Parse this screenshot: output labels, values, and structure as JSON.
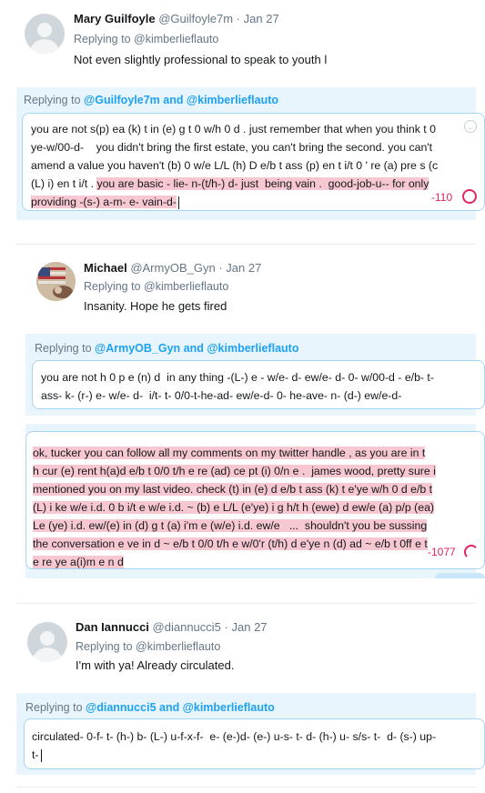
{
  "tweet1": {
    "name": "Mary Guilfoyle",
    "handle": "@Guilfoyle7m",
    "date": "Jan 27",
    "replying_to": "Replying to @kimberlieflauto",
    "text": "Not even slightly professional to speak to youth l"
  },
  "reply1": {
    "label": "Replying to",
    "mentions": "@Guilfoyle7m and @kimberlieflauto",
    "lines": [
      "you are not s(p) ea (k) t in (e) g t 0 w/h 0 d . just remember that when you think t 0",
      "ye-w/00-d-    you didn't bring the first estate, you can't bring the second. you can't",
      "amend a value you haven't (b) 0 w/e L/L (h) D e/b t ass (p) en t i/t 0 ' re (a) pre s (c",
      "(L) i) en t i/t .",
      "you are basic - lie- n-(t/h-) d- just  being vain .  good-job-u-- for only",
      "providing -(s-) a-m- e- vain-d-"
    ],
    "counter": "-110"
  },
  "tweet2": {
    "name": "Michael",
    "handle": "@ArmyOB_Gyn",
    "date": "Jan 27",
    "replying_to": "Replying to @kimberlieflauto",
    "text": "Insanity.  Hope he gets fired"
  },
  "reply2": {
    "label": "Replying to",
    "mentions": "@ArmyOB_Gyn and @kimberlieflauto",
    "lines": [
      "you are not h 0 p e (n) d  in any thing -(L-) e - w/e- d- ew/e- d- 0- w/00-d - e/b- t-",
      "ass- k- (r-) e- w/e- d-  i/t- t- 0/0-t-he-ad- ew/e-d- 0- he-ave- n- (d-) ew/e-d-"
    ]
  },
  "reply3": {
    "lines": [
      "ok, tucker you can follow all my comments on my twitter handle , as you are in t",
      "h cur (e) rent h(a)d e/b t 0/0 t/h e re (ad) ce pt (i) 0/n e .  james wood, pretty sure i",
      "mentioned you on my last video. check (t) in (e) d e/b t ass (k) t e'ye w/h 0 d e/b t",
      "(L) i ke w/e i.d. 0 b i/t e w/e i.d. ~ (b) e L/L (e'ye) i g h/t h (ewe) d ew/e (a) p/p (ea)",
      "Le (ye) i.d. ew/(e) in (d) g t (a) i'm e (w/e) i.d. ew/e   ...  shouldn't you be sussing",
      "the conversation e ve in d ~ e/b t 0/0 t/h e w/0'r (t/h) d e'ye n (d) ad ~ e/b t 0ff e t",
      "e re ye a(i)m e n d"
    ],
    "counter": "-1077"
  },
  "tweet3": {
    "name": "Dan Iannucci",
    "handle": "@diannucci5",
    "date": "Jan 27",
    "replying_to": "Replying to @kimberlieflauto",
    "text": "I'm with ya!  Already circulated."
  },
  "reply4": {
    "label": "Replying to",
    "mentions": "@diannucci5 and @kimberlieflauto",
    "lines": [
      "circulated- 0-f- t- (h-) b- (L-) u-f-x-f-  e- (e-)d- (e-) u-s- t- d- (h-) u- s/s- t-  d- (s-) up-",
      "t-"
    ]
  },
  "colors": {
    "link": "#1da1f2",
    "highlight": "#f8c8d2",
    "counter": "#e0245e",
    "reply_bar": "#e8f5fd"
  }
}
